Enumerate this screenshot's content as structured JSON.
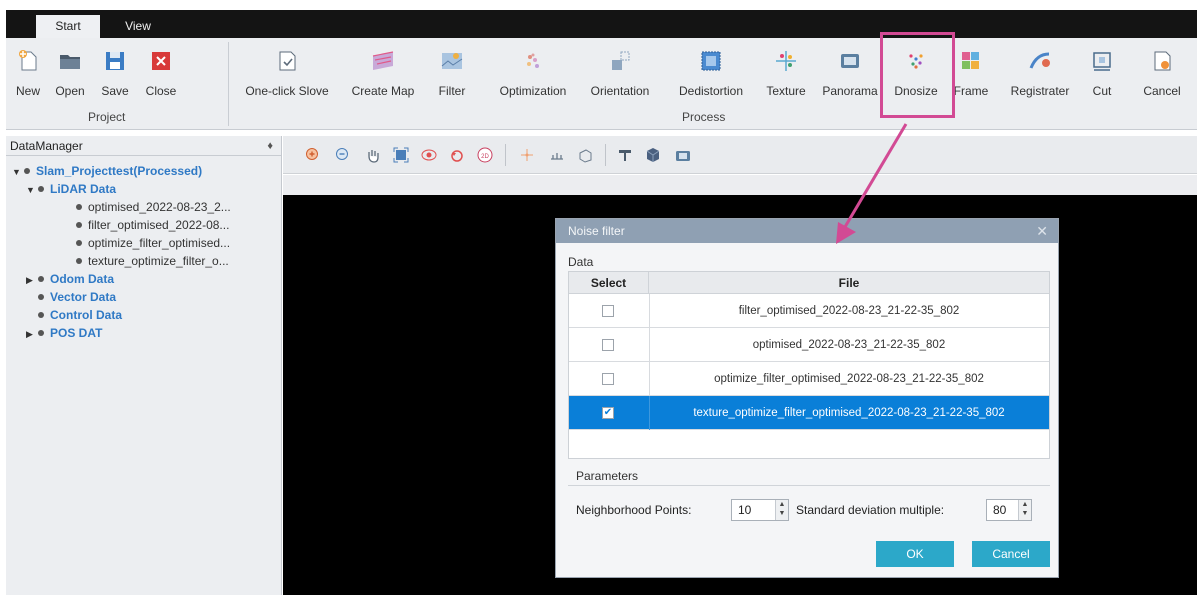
{
  "tabs": {
    "start": "Start",
    "view": "View"
  },
  "ribbon": {
    "project_group": "Project",
    "process_group": "Process",
    "buttons": {
      "new": "New",
      "open": "Open",
      "save": "Save",
      "close": "Close",
      "one_click": "One-click Slove",
      "create_map": "Create Map",
      "filter": "Filter",
      "optimization": "Optimization",
      "orientation": "Orientation",
      "dedistortion": "Dedistortion",
      "texture": "Texture",
      "panorama": "Panorama",
      "dnosize": "Dnosize",
      "frame": "Frame",
      "registrater": "Registrater",
      "cut": "Cut",
      "cancel": "Cancel"
    }
  },
  "data_manager": {
    "title": "DataManager",
    "project": "Slam_Projecttest(Processed)",
    "lidar": "LiDAR Data",
    "lidar_items": [
      "optimised_2022-08-23_2...",
      "filter_optimised_2022-08...",
      "optimize_filter_optimised...",
      "texture_optimize_filter_o..."
    ],
    "odom": "Odom Data",
    "vector": "Vector Data",
    "control": "Control Data",
    "pos": "POS DAT"
  },
  "dialog": {
    "title": "Noise filter",
    "data_label": "Data",
    "col_select": "Select",
    "col_file": "File",
    "rows": [
      {
        "file": "filter_optimised_2022-08-23_21-22-35_802",
        "checked": false
      },
      {
        "file": "optimised_2022-08-23_21-22-35_802",
        "checked": false
      },
      {
        "file": "optimize_filter_optimised_2022-08-23_21-22-35_802",
        "checked": false
      },
      {
        "file": "texture_optimize_filter_optimised_2022-08-23_21-22-35_802",
        "checked": true
      }
    ],
    "params_label": "Parameters",
    "neighborhood_label": "Neighborhood Points:",
    "neighborhood_value": "10",
    "stddev_label": "Standard deviation multiple:",
    "stddev_value": "80",
    "ok": "OK",
    "cancel": "Cancel"
  },
  "colors": {
    "highlight": "#d24a94",
    "selection": "#0a7fd8",
    "dialog_button": "#2ca8c9",
    "tree_text": "#2f79c5"
  }
}
